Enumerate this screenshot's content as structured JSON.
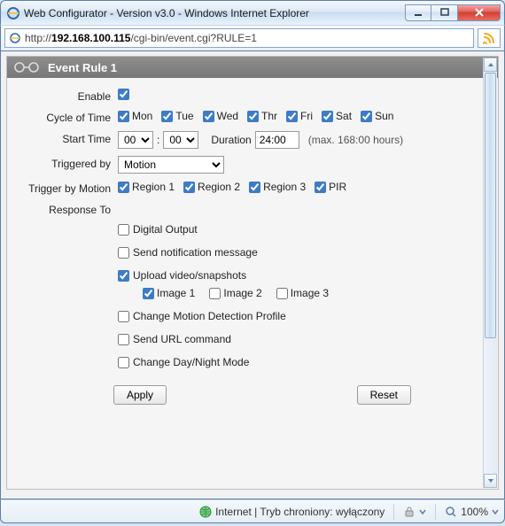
{
  "window": {
    "title": "Web Configurator - Version v3.0 - Windows Internet Explorer"
  },
  "address": {
    "scheme": "http://",
    "host": "192.168.100.115",
    "path": "/cgi-bin/event.cgi?RULE=1"
  },
  "ruleHeader": {
    "title": "Event Rule 1"
  },
  "labels": {
    "enable": "Enable",
    "cycle": "Cycle of Time",
    "start": "Start Time",
    "duration": "Duration",
    "durHint": "(max. 168:00 hours)",
    "triggeredBy": "Triggered by",
    "triggerMotion": "Trigger by Motion",
    "responseTo": "Response To"
  },
  "days": {
    "mon": "Mon",
    "tue": "Tue",
    "wed": "Wed",
    "thr": "Thr",
    "fri": "Fri",
    "sat": "Sat",
    "sun": "Sun"
  },
  "start": {
    "hour": "00",
    "minute": "00"
  },
  "duration": "24:00",
  "triggeredByValue": "Motion",
  "regions": {
    "r1": "Region 1",
    "r2": "Region 2",
    "r3": "Region 3",
    "pir": "PIR"
  },
  "responses": {
    "digital": "Digital Output",
    "notify": "Send notification message",
    "upload": "Upload video/snapshots",
    "img1": "Image 1",
    "img2": "Image 2",
    "img3": "Image 3",
    "profile": "Change Motion Detection Profile",
    "url": "Send URL command",
    "daynight": "Change Day/Night Mode"
  },
  "buttons": {
    "apply": "Apply",
    "reset": "Reset"
  },
  "status": {
    "zone": "Internet | Tryb chroniony: wyłączony",
    "zoom": "100%"
  }
}
